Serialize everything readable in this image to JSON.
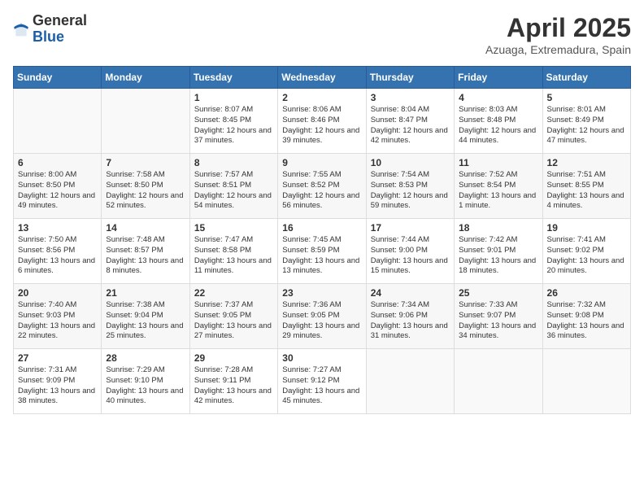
{
  "header": {
    "logo_general": "General",
    "logo_blue": "Blue",
    "month_title": "April 2025",
    "location": "Azuaga, Extremadura, Spain"
  },
  "days_of_week": [
    "Sunday",
    "Monday",
    "Tuesday",
    "Wednesday",
    "Thursday",
    "Friday",
    "Saturday"
  ],
  "weeks": [
    [
      {
        "day": "",
        "sunrise": "",
        "sunset": "",
        "daylight": ""
      },
      {
        "day": "",
        "sunrise": "",
        "sunset": "",
        "daylight": ""
      },
      {
        "day": "1",
        "sunrise": "Sunrise: 8:07 AM",
        "sunset": "Sunset: 8:45 PM",
        "daylight": "Daylight: 12 hours and 37 minutes."
      },
      {
        "day": "2",
        "sunrise": "Sunrise: 8:06 AM",
        "sunset": "Sunset: 8:46 PM",
        "daylight": "Daylight: 12 hours and 39 minutes."
      },
      {
        "day": "3",
        "sunrise": "Sunrise: 8:04 AM",
        "sunset": "Sunset: 8:47 PM",
        "daylight": "Daylight: 12 hours and 42 minutes."
      },
      {
        "day": "4",
        "sunrise": "Sunrise: 8:03 AM",
        "sunset": "Sunset: 8:48 PM",
        "daylight": "Daylight: 12 hours and 44 minutes."
      },
      {
        "day": "5",
        "sunrise": "Sunrise: 8:01 AM",
        "sunset": "Sunset: 8:49 PM",
        "daylight": "Daylight: 12 hours and 47 minutes."
      }
    ],
    [
      {
        "day": "6",
        "sunrise": "Sunrise: 8:00 AM",
        "sunset": "Sunset: 8:50 PM",
        "daylight": "Daylight: 12 hours and 49 minutes."
      },
      {
        "day": "7",
        "sunrise": "Sunrise: 7:58 AM",
        "sunset": "Sunset: 8:50 PM",
        "daylight": "Daylight: 12 hours and 52 minutes."
      },
      {
        "day": "8",
        "sunrise": "Sunrise: 7:57 AM",
        "sunset": "Sunset: 8:51 PM",
        "daylight": "Daylight: 12 hours and 54 minutes."
      },
      {
        "day": "9",
        "sunrise": "Sunrise: 7:55 AM",
        "sunset": "Sunset: 8:52 PM",
        "daylight": "Daylight: 12 hours and 56 minutes."
      },
      {
        "day": "10",
        "sunrise": "Sunrise: 7:54 AM",
        "sunset": "Sunset: 8:53 PM",
        "daylight": "Daylight: 12 hours and 59 minutes."
      },
      {
        "day": "11",
        "sunrise": "Sunrise: 7:52 AM",
        "sunset": "Sunset: 8:54 PM",
        "daylight": "Daylight: 13 hours and 1 minute."
      },
      {
        "day": "12",
        "sunrise": "Sunrise: 7:51 AM",
        "sunset": "Sunset: 8:55 PM",
        "daylight": "Daylight: 13 hours and 4 minutes."
      }
    ],
    [
      {
        "day": "13",
        "sunrise": "Sunrise: 7:50 AM",
        "sunset": "Sunset: 8:56 PM",
        "daylight": "Daylight: 13 hours and 6 minutes."
      },
      {
        "day": "14",
        "sunrise": "Sunrise: 7:48 AM",
        "sunset": "Sunset: 8:57 PM",
        "daylight": "Daylight: 13 hours and 8 minutes."
      },
      {
        "day": "15",
        "sunrise": "Sunrise: 7:47 AM",
        "sunset": "Sunset: 8:58 PM",
        "daylight": "Daylight: 13 hours and 11 minutes."
      },
      {
        "day": "16",
        "sunrise": "Sunrise: 7:45 AM",
        "sunset": "Sunset: 8:59 PM",
        "daylight": "Daylight: 13 hours and 13 minutes."
      },
      {
        "day": "17",
        "sunrise": "Sunrise: 7:44 AM",
        "sunset": "Sunset: 9:00 PM",
        "daylight": "Daylight: 13 hours and 15 minutes."
      },
      {
        "day": "18",
        "sunrise": "Sunrise: 7:42 AM",
        "sunset": "Sunset: 9:01 PM",
        "daylight": "Daylight: 13 hours and 18 minutes."
      },
      {
        "day": "19",
        "sunrise": "Sunrise: 7:41 AM",
        "sunset": "Sunset: 9:02 PM",
        "daylight": "Daylight: 13 hours and 20 minutes."
      }
    ],
    [
      {
        "day": "20",
        "sunrise": "Sunrise: 7:40 AM",
        "sunset": "Sunset: 9:03 PM",
        "daylight": "Daylight: 13 hours and 22 minutes."
      },
      {
        "day": "21",
        "sunrise": "Sunrise: 7:38 AM",
        "sunset": "Sunset: 9:04 PM",
        "daylight": "Daylight: 13 hours and 25 minutes."
      },
      {
        "day": "22",
        "sunrise": "Sunrise: 7:37 AM",
        "sunset": "Sunset: 9:05 PM",
        "daylight": "Daylight: 13 hours and 27 minutes."
      },
      {
        "day": "23",
        "sunrise": "Sunrise: 7:36 AM",
        "sunset": "Sunset: 9:05 PM",
        "daylight": "Daylight: 13 hours and 29 minutes."
      },
      {
        "day": "24",
        "sunrise": "Sunrise: 7:34 AM",
        "sunset": "Sunset: 9:06 PM",
        "daylight": "Daylight: 13 hours and 31 minutes."
      },
      {
        "day": "25",
        "sunrise": "Sunrise: 7:33 AM",
        "sunset": "Sunset: 9:07 PM",
        "daylight": "Daylight: 13 hours and 34 minutes."
      },
      {
        "day": "26",
        "sunrise": "Sunrise: 7:32 AM",
        "sunset": "Sunset: 9:08 PM",
        "daylight": "Daylight: 13 hours and 36 minutes."
      }
    ],
    [
      {
        "day": "27",
        "sunrise": "Sunrise: 7:31 AM",
        "sunset": "Sunset: 9:09 PM",
        "daylight": "Daylight: 13 hours and 38 minutes."
      },
      {
        "day": "28",
        "sunrise": "Sunrise: 7:29 AM",
        "sunset": "Sunset: 9:10 PM",
        "daylight": "Daylight: 13 hours and 40 minutes."
      },
      {
        "day": "29",
        "sunrise": "Sunrise: 7:28 AM",
        "sunset": "Sunset: 9:11 PM",
        "daylight": "Daylight: 13 hours and 42 minutes."
      },
      {
        "day": "30",
        "sunrise": "Sunrise: 7:27 AM",
        "sunset": "Sunset: 9:12 PM",
        "daylight": "Daylight: 13 hours and 45 minutes."
      },
      {
        "day": "",
        "sunrise": "",
        "sunset": "",
        "daylight": ""
      },
      {
        "day": "",
        "sunrise": "",
        "sunset": "",
        "daylight": ""
      },
      {
        "day": "",
        "sunrise": "",
        "sunset": "",
        "daylight": ""
      }
    ]
  ]
}
